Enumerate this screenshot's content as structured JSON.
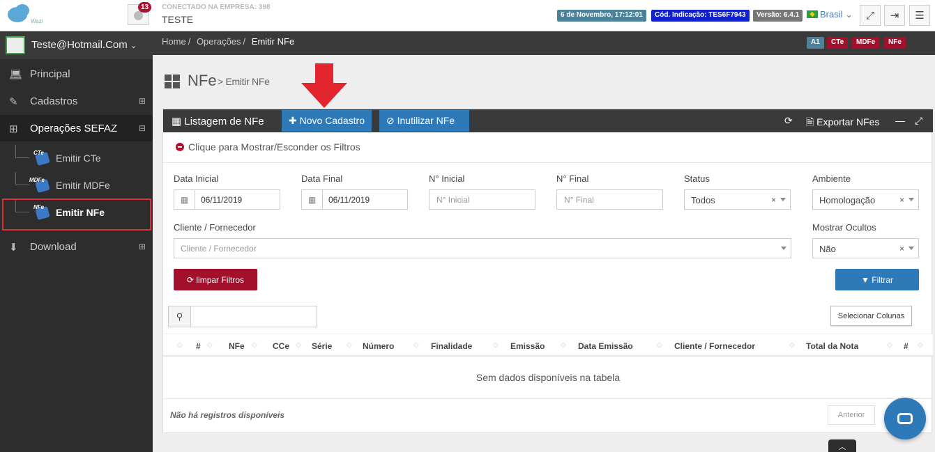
{
  "app": {
    "logo_text": "Wazi"
  },
  "topbar": {
    "notifications_count": "13",
    "company_label": "CONECTADO NA EMPRESA: 398",
    "company_name": "TESTE",
    "datetime": "6 de Novembro, 17:12:01",
    "referral_code": "Cód. Indicação: TES6F7943",
    "version": "Versão: 6.4.1",
    "language": "Brasil",
    "colors": {
      "datetime_bg": "#4b8199",
      "referral_bg": "#1122cc",
      "version_bg": "#777777"
    }
  },
  "sidebar": {
    "user": "Teste@Hotmail.Com",
    "items": [
      {
        "label": "Principal",
        "icon": "laptop-icon"
      },
      {
        "label": "Cadastros",
        "icon": "edit-icon"
      },
      {
        "label": "Operações SEFAZ",
        "icon": "windows-icon"
      },
      {
        "label": "Download",
        "icon": "download-icon"
      }
    ],
    "subitems": [
      {
        "tag": "CTe",
        "label": "Emitir CTe"
      },
      {
        "tag": "MDFe",
        "label": "Emitir MDFe"
      },
      {
        "tag": "NFe",
        "label": "Emitir NFe"
      }
    ]
  },
  "breadcrumb": {
    "home": "Home",
    "section": "Operações",
    "current": "Emitir NFe"
  },
  "doc_badges": [
    {
      "label": "A1",
      "color": "#4b8199"
    },
    {
      "label": "CTe",
      "color": "#a3102c"
    },
    {
      "label": "MDFe",
      "color": "#a3102c"
    },
    {
      "label": "NFe",
      "color": "#a3102c"
    }
  ],
  "page": {
    "title": "NFe",
    "subtitle": "> Emitir NFe"
  },
  "panel": {
    "title": "Listagem de NFe",
    "new_button": "Novo Cadastro",
    "void_button": "Inutilizar NFe",
    "export_button": "Exportar NFes",
    "filter_toggle": "Clique para Mostrar/Esconder os Filtros"
  },
  "filters": {
    "data_inicial": {
      "label": "Data Inicial",
      "value": "06/11/2019"
    },
    "data_final": {
      "label": "Data Final",
      "value": "06/11/2019"
    },
    "n_inicial": {
      "label": "N° Inicial",
      "placeholder": "N° Inicial"
    },
    "n_final": {
      "label": "N° Final",
      "placeholder": "N° Final"
    },
    "status": {
      "label": "Status",
      "value": "Todos"
    },
    "ambiente": {
      "label": "Ambiente",
      "value": "Homologação"
    },
    "cliente": {
      "label": "Cliente / Fornecedor",
      "placeholder": "Cliente / Fornecedor"
    },
    "ocultos": {
      "label": "Mostrar Ocultos",
      "value": "Não"
    },
    "clear_button": "limpar Filtros",
    "filter_button": "Filtrar"
  },
  "table": {
    "select_columns": "Selecionar Colunas",
    "columns": [
      "#",
      "NFe",
      "CCe",
      "Série",
      "Número",
      "Finalidade",
      "Emissão",
      "Data Emissão",
      "Cliente / Fornecedor",
      "Total da Nota",
      "#"
    ],
    "empty": "Sem dados disponíveis na tabela",
    "info": "Não há registros disponíveis",
    "prev": "Anterior"
  }
}
